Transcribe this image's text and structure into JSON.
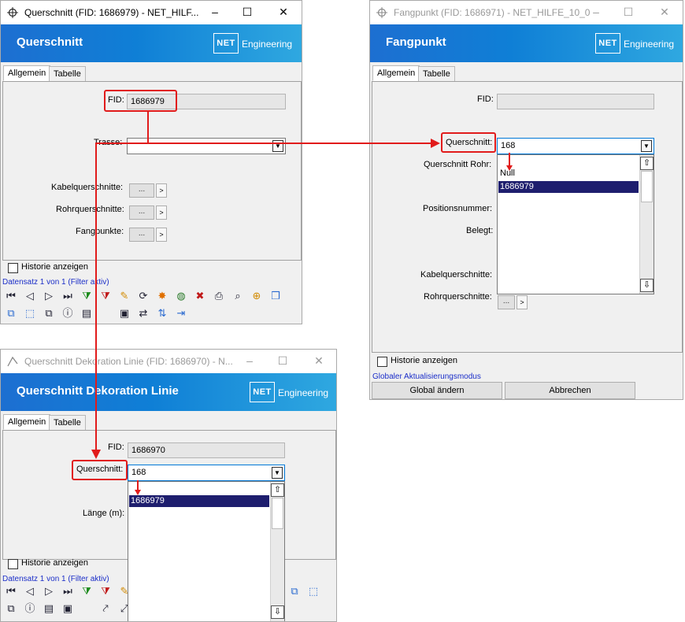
{
  "win1": {
    "title": "Querschnitt (FID: 1686979) - NET_HILF...",
    "banner_title": "Querschnitt",
    "logo": "NET",
    "logo_text": "Engineering",
    "tabs": [
      "Allgemein",
      "Tabelle"
    ],
    "fid_label": "FID:",
    "fid_value": "1686979",
    "trasse_label": "Trasse:",
    "kabel_label": "Kabelquerschnitte:",
    "rohr_label": "Rohrquerschnitte:",
    "fang_label": "Fangpunkte:",
    "dots": "...",
    "nav": ">",
    "historie": "Historie anzeigen",
    "status": "Datensatz 1 von 1 (Filter aktiv)",
    "minimize": "–",
    "maximize": "☐",
    "close": "✕"
  },
  "win2": {
    "title": "Fangpunkt (FID: 1686971) - NET_HILFE_10_0",
    "banner_title": "Fangpunkt",
    "logo": "NET",
    "logo_text": "Engineering",
    "tabs": [
      "Allgemein",
      "Tabelle"
    ],
    "fid_label": "FID:",
    "fid_value": "",
    "querschnitt_label": "Querschnitt:",
    "querschnitt_value": "168",
    "qrohr_label": "Querschnitt Rohr:",
    "pos_label": "Positionsnummer:",
    "belegt_label": "Belegt:",
    "kabel_label": "Kabelquerschnitte:",
    "rohr_label": "Rohrquerschnitte:",
    "dots": "...",
    "nav": ">",
    "dropdown_items": [
      "Null",
      "1686979"
    ],
    "historie": "Historie anzeigen",
    "status": "Globaler Aktualisierungsmodus",
    "global_button": "Global ändern",
    "cancel_button": "Abbrechen",
    "minimize": "–",
    "maximize": "☐",
    "close": "✕"
  },
  "win3": {
    "title": "Querschnitt Dekoration Linie (FID: 1686970) - N...",
    "banner_title": "Querschnitt Dekoration Linie",
    "logo": "NET",
    "logo_text": "Engineering",
    "tabs": [
      "Allgemein",
      "Tabelle"
    ],
    "fid_label": "FID:",
    "fid_value": "1686970",
    "querschnitt_label": "Querschnitt:",
    "querschnitt_value": "168",
    "laenge_label": "Länge (m):",
    "dropdown_items": [
      "1686979"
    ],
    "historie": "Historie anzeigen",
    "status": "Datensatz 1 von 1 (Filter aktiv)",
    "minimize": "–",
    "maximize": "☐",
    "close": "✕"
  },
  "colors": {
    "accent": "#0f7fd6",
    "highlight": "#e11b1b",
    "selection": "#1e1e6e",
    "status_text": "#1a2dc8"
  },
  "icons": {
    "toolbar1_row1": [
      "first-record-icon",
      "prev-record-icon",
      "next-record-icon",
      "last-record-icon",
      "add-filter-icon",
      "remove-filter-icon",
      "edit-pencil-icon",
      "refresh-icon",
      "highlight-icon",
      "zoom-globe-icon",
      "delete-icon",
      "print-icon",
      "zoom-icon",
      "zoom-in-icon",
      "cube-icon"
    ],
    "toolbar1_row2": [
      "copy-shapes-icon",
      "select-icon",
      "overlap-icon",
      "info-icon",
      "document-icon",
      "image-add-icon",
      "move-icon",
      "sort-icon",
      "export-icon"
    ]
  }
}
